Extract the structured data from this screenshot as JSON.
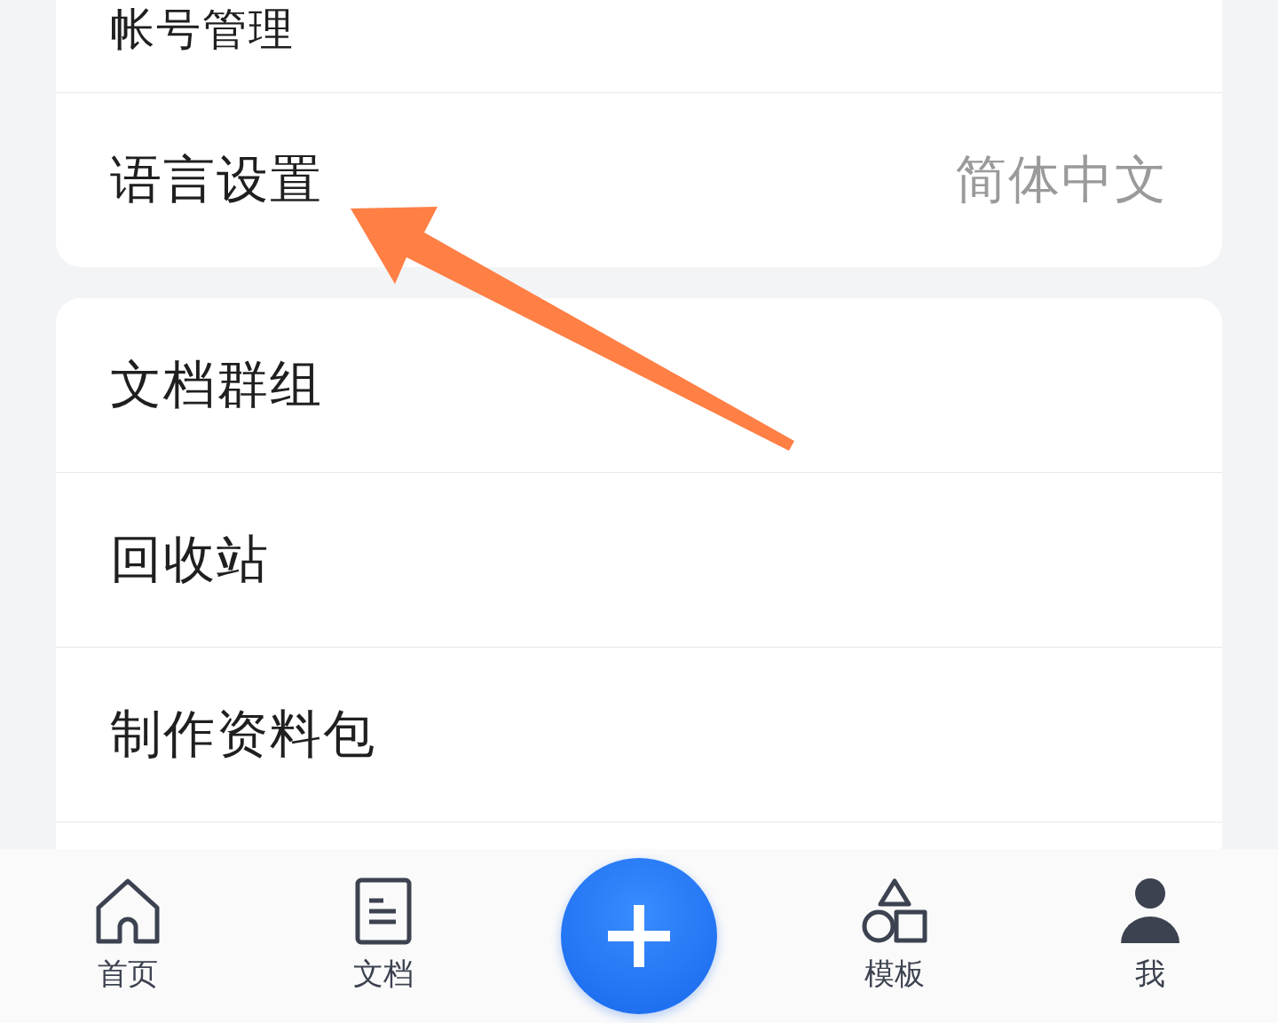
{
  "settings_groups": [
    {
      "rows": [
        {
          "label": "帐号管理"
        },
        {
          "label": "语言设置",
          "value": "简体中文"
        }
      ]
    },
    {
      "rows": [
        {
          "label": "文档群组"
        },
        {
          "label": "回收站"
        },
        {
          "label": "制作资料包"
        },
        {
          "label": ""
        }
      ]
    }
  ],
  "bottom_nav": [
    {
      "kind": "home",
      "label": "首页"
    },
    {
      "kind": "document",
      "label": "文档"
    },
    {
      "kind": "add"
    },
    {
      "kind": "template",
      "label": "模板"
    },
    {
      "kind": "profile",
      "label": "我"
    }
  ]
}
